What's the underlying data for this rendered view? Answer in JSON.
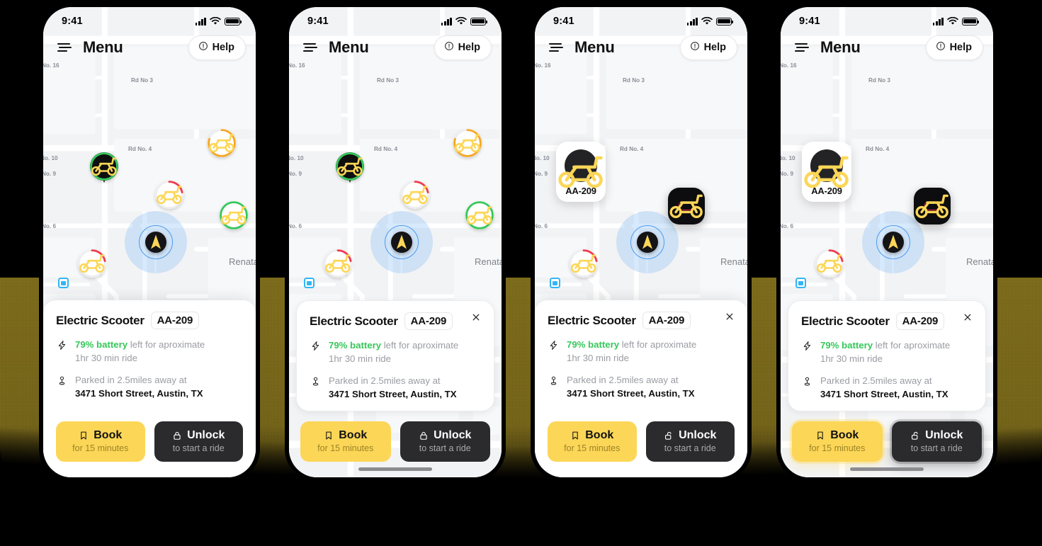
{
  "app": {
    "status_bar": {
      "time": "9:41",
      "signal_icon": "signal-bars-icon",
      "wifi_icon": "wifi-icon",
      "battery_icon": "battery-icon"
    },
    "top_bar": {
      "menu_icon": "hamburger-menu-icon",
      "title": "Menu",
      "help_label": "Help",
      "help_icon": "info-circle-icon"
    }
  },
  "map": {
    "labels": [
      {
        "text": "No. 16"
      },
      {
        "text": "Rd No 3"
      },
      {
        "text": "Rd No. 4"
      },
      {
        "text": "No. 10"
      },
      {
        "text": "No. 9"
      },
      {
        "text": "No. 6"
      },
      {
        "text": "Renata"
      }
    ],
    "transit_icon": "transit-station-icon",
    "user_location_icon": "navigation-arrow-icon",
    "scooter_icon": "scooter-icon",
    "pin_ring_colors": {
      "full": "#35c759",
      "medium": "#f5a623",
      "low": "#ef3b4e",
      "selected": "#0f0f10"
    }
  },
  "callout": {
    "code": "AA-209",
    "scooter_icon": "scooter-icon"
  },
  "low_battery_marker": {
    "scooter_icon": "scooter-icon",
    "battery_icon": "battery-empty-icon",
    "color": "#e8174b"
  },
  "card": {
    "title": "Electric Scooter",
    "plate": "AA-209",
    "close_icon": "close-icon",
    "battery_icon": "lightning-bolt-icon",
    "battery_value": "79% battery",
    "battery_rest": " left for aproximate",
    "battery_line2": "1hr 30 min ride",
    "location_icon": "map-pin-icon",
    "location_line1": "Parked in 2.5miles away at",
    "location_line2": "3471 Short Street, Austin, TX"
  },
  "buttons": {
    "book": {
      "label": "Book",
      "sub": "for 15 minutes",
      "icon": "bookmark-icon",
      "color": "#fcd657"
    },
    "unlock_closed": {
      "label": "Unlock",
      "sub": "to start a ride",
      "icon": "lock-closed-icon",
      "color": "#2b2b2e"
    },
    "unlock_open": {
      "label": "Unlock",
      "sub": "to start a ride",
      "icon": "lock-open-icon",
      "color": "#2b2b2e"
    }
  },
  "phones": [
    {
      "id": "phone-1",
      "variant": "sheet-attached",
      "close_button": false,
      "unlock_icon": "lock-closed-icon",
      "home_indicator": false,
      "selected_callout": false,
      "glow": false
    },
    {
      "id": "phone-2",
      "variant": "sheet-floating",
      "close_button": true,
      "unlock_icon": "lock-closed-icon",
      "home_indicator": true,
      "selected_callout": false,
      "glow": false
    },
    {
      "id": "phone-3",
      "variant": "sheet-attached",
      "close_button": true,
      "unlock_icon": "lock-open-icon",
      "home_indicator": false,
      "selected_callout": true,
      "glow": false
    },
    {
      "id": "phone-4",
      "variant": "sheet-floating",
      "close_button": true,
      "unlock_icon": "lock-open-icon",
      "home_indicator": true,
      "selected_callout": true,
      "glow": true
    }
  ]
}
